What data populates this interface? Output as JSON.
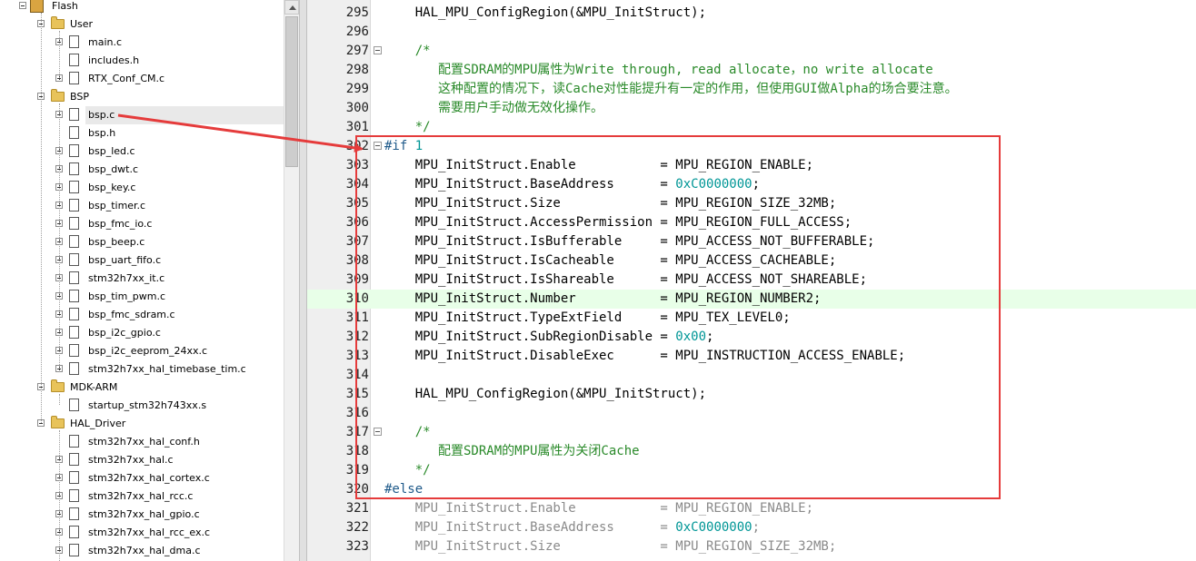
{
  "tree": {
    "rows": [
      {
        "kind": "project",
        "label": "Flash",
        "level": 0,
        "expander": "minus"
      },
      {
        "kind": "folder",
        "label": "User",
        "level": 1,
        "expander": "minus"
      },
      {
        "kind": "file",
        "label": "main.c",
        "level": 2,
        "expander": "plus"
      },
      {
        "kind": "file",
        "label": "includes.h",
        "level": 2,
        "expander": "none"
      },
      {
        "kind": "file",
        "label": "RTX_Conf_CM.c",
        "level": 2,
        "expander": "plus"
      },
      {
        "kind": "folder",
        "label": "BSP",
        "level": 1,
        "expander": "minus"
      },
      {
        "kind": "file",
        "label": "bsp.c",
        "level": 2,
        "expander": "plus",
        "selected": true
      },
      {
        "kind": "file",
        "label": "bsp.h",
        "level": 2,
        "expander": "none"
      },
      {
        "kind": "file",
        "label": "bsp_led.c",
        "level": 2,
        "expander": "plus"
      },
      {
        "kind": "file",
        "label": "bsp_dwt.c",
        "level": 2,
        "expander": "plus"
      },
      {
        "kind": "file",
        "label": "bsp_key.c",
        "level": 2,
        "expander": "plus"
      },
      {
        "kind": "file",
        "label": "bsp_timer.c",
        "level": 2,
        "expander": "plus"
      },
      {
        "kind": "file",
        "label": "bsp_fmc_io.c",
        "level": 2,
        "expander": "plus"
      },
      {
        "kind": "file",
        "label": "bsp_beep.c",
        "level": 2,
        "expander": "plus"
      },
      {
        "kind": "file",
        "label": "bsp_uart_fifo.c",
        "level": 2,
        "expander": "plus"
      },
      {
        "kind": "file",
        "label": "stm32h7xx_it.c",
        "level": 2,
        "expander": "plus"
      },
      {
        "kind": "file",
        "label": "bsp_tim_pwm.c",
        "level": 2,
        "expander": "plus"
      },
      {
        "kind": "file",
        "label": "bsp_fmc_sdram.c",
        "level": 2,
        "expander": "plus"
      },
      {
        "kind": "file",
        "label": "bsp_i2c_gpio.c",
        "level": 2,
        "expander": "plus"
      },
      {
        "kind": "file",
        "label": "bsp_i2c_eeprom_24xx.c",
        "level": 2,
        "expander": "plus"
      },
      {
        "kind": "file",
        "label": "stm32h7xx_hal_timebase_tim.c",
        "level": 2,
        "expander": "plus"
      },
      {
        "kind": "folder",
        "label": "MDK-ARM",
        "level": 1,
        "expander": "minus"
      },
      {
        "kind": "file",
        "label": "startup_stm32h743xx.s",
        "level": 2,
        "expander": "none"
      },
      {
        "kind": "folder",
        "label": "HAL_Driver",
        "level": 1,
        "expander": "minus"
      },
      {
        "kind": "file",
        "label": "stm32h7xx_hal_conf.h",
        "level": 2,
        "expander": "none"
      },
      {
        "kind": "file",
        "label": "stm32h7xx_hal.c",
        "level": 2,
        "expander": "plus"
      },
      {
        "kind": "file",
        "label": "stm32h7xx_hal_cortex.c",
        "level": 2,
        "expander": "plus"
      },
      {
        "kind": "file",
        "label": "stm32h7xx_hal_rcc.c",
        "level": 2,
        "expander": "plus"
      },
      {
        "kind": "file",
        "label": "stm32h7xx_hal_gpio.c",
        "level": 2,
        "expander": "plus"
      },
      {
        "kind": "file",
        "label": "stm32h7xx_hal_rcc_ex.c",
        "level": 2,
        "expander": "plus"
      },
      {
        "kind": "file",
        "label": "stm32h7xx_hal_dma.c",
        "level": 2,
        "expander": "plus"
      }
    ]
  },
  "editor": {
    "lines": [
      {
        "num": "295",
        "fold": false,
        "tokens": [
          [
            "plain",
            "    HAL_MPU_ConfigRegion(&MPU_InitStruct);"
          ]
        ]
      },
      {
        "num": "296",
        "fold": false,
        "tokens": []
      },
      {
        "num": "297",
        "fold": true,
        "tokens": [
          [
            "comment",
            "    /*"
          ]
        ]
      },
      {
        "num": "298",
        "fold": false,
        "tokens": [
          [
            "comment",
            "       配置SDRAM的MPU属性为Write through, read allocate，no write allocate"
          ]
        ]
      },
      {
        "num": "299",
        "fold": false,
        "tokens": [
          [
            "comment",
            "       这种配置的情况下，读Cache对性能提升有一定的作用，但使用GUI做Alpha的场合要注意。"
          ]
        ]
      },
      {
        "num": "300",
        "fold": false,
        "tokens": [
          [
            "comment",
            "       需要用户手动做无效化操作。"
          ]
        ]
      },
      {
        "num": "301",
        "fold": false,
        "tokens": [
          [
            "comment",
            "    */"
          ]
        ]
      },
      {
        "num": "302",
        "fold": true,
        "tokens": [
          [
            "dir",
            "#if "
          ],
          [
            "number",
            "1"
          ]
        ]
      },
      {
        "num": "303",
        "fold": false,
        "tokens": [
          [
            "plain",
            "    MPU_InitStruct.Enable           = MPU_REGION_ENABLE;"
          ]
        ]
      },
      {
        "num": "304",
        "fold": false,
        "tokens": [
          [
            "plain",
            "    MPU_InitStruct.BaseAddress      = "
          ],
          [
            "number",
            "0xC0000000"
          ],
          [
            "plain",
            ";"
          ]
        ]
      },
      {
        "num": "305",
        "fold": false,
        "tokens": [
          [
            "plain",
            "    MPU_InitStruct.Size             = MPU_REGION_SIZE_32MB;"
          ]
        ]
      },
      {
        "num": "306",
        "fold": false,
        "tokens": [
          [
            "plain",
            "    MPU_InitStruct.AccessPermission = MPU_REGION_FULL_ACCESS;"
          ]
        ]
      },
      {
        "num": "307",
        "fold": false,
        "tokens": [
          [
            "plain",
            "    MPU_InitStruct.IsBufferable     = MPU_ACCESS_NOT_BUFFERABLE;"
          ]
        ]
      },
      {
        "num": "308",
        "fold": false,
        "tokens": [
          [
            "plain",
            "    MPU_InitStruct.IsCacheable      = MPU_ACCESS_CACHEABLE;"
          ]
        ]
      },
      {
        "num": "309",
        "fold": false,
        "tokens": [
          [
            "plain",
            "    MPU_InitStruct.IsShareable      = MPU_ACCESS_NOT_SHAREABLE;"
          ]
        ]
      },
      {
        "num": "310",
        "fold": false,
        "current": true,
        "tokens": [
          [
            "plain",
            "    MPU_InitStruct.Number           = MPU_REGION_NUMBER2;"
          ]
        ]
      },
      {
        "num": "311",
        "fold": false,
        "tokens": [
          [
            "plain",
            "    MPU_InitStruct.TypeExtField     = MPU_TEX_LEVEL0;"
          ]
        ]
      },
      {
        "num": "312",
        "fold": false,
        "tokens": [
          [
            "plain",
            "    MPU_InitStruct.SubRegionDisable = "
          ],
          [
            "number",
            "0x00"
          ],
          [
            "plain",
            ";"
          ]
        ]
      },
      {
        "num": "313",
        "fold": false,
        "tokens": [
          [
            "plain",
            "    MPU_InitStruct.DisableExec      = MPU_INSTRUCTION_ACCESS_ENABLE;"
          ]
        ]
      },
      {
        "num": "314",
        "fold": false,
        "tokens": []
      },
      {
        "num": "315",
        "fold": false,
        "tokens": [
          [
            "plain",
            "    HAL_MPU_ConfigRegion(&MPU_InitStruct);"
          ]
        ]
      },
      {
        "num": "316",
        "fold": false,
        "tokens": []
      },
      {
        "num": "317",
        "fold": true,
        "tokens": [
          [
            "comment",
            "    /*"
          ]
        ]
      },
      {
        "num": "318",
        "fold": false,
        "tokens": [
          [
            "comment",
            "       配置SDRAM的MPU属性为关闭Cache"
          ]
        ]
      },
      {
        "num": "319",
        "fold": false,
        "tokens": [
          [
            "comment",
            "    */"
          ]
        ]
      },
      {
        "num": "320",
        "fold": false,
        "tokens": [
          [
            "dir",
            "#else"
          ]
        ]
      },
      {
        "num": "321",
        "fold": false,
        "tokens": [
          [
            "grey",
            "    MPU_InitStruct.Enable           = MPU_REGION_ENABLE;"
          ]
        ]
      },
      {
        "num": "322",
        "fold": false,
        "tokens": [
          [
            "grey",
            "    MPU_InitStruct.BaseAddress      = "
          ],
          [
            "number",
            "0xC0000000"
          ],
          [
            "grey",
            ";"
          ]
        ]
      },
      {
        "num": "323",
        "fold": false,
        "tokens": [
          [
            "grey",
            "    MPU_InitStruct.Size             = MPU_REGION_SIZE_32MB;"
          ]
        ]
      }
    ]
  },
  "colors": {
    "annotation": "#e53b3b",
    "comment": "#2a8a2a",
    "number": "#009696",
    "directive": "#1f5a8a",
    "inactive_code": "#8a8a8a",
    "current_line": "#e8ffe8",
    "gutter": "#efefef"
  }
}
